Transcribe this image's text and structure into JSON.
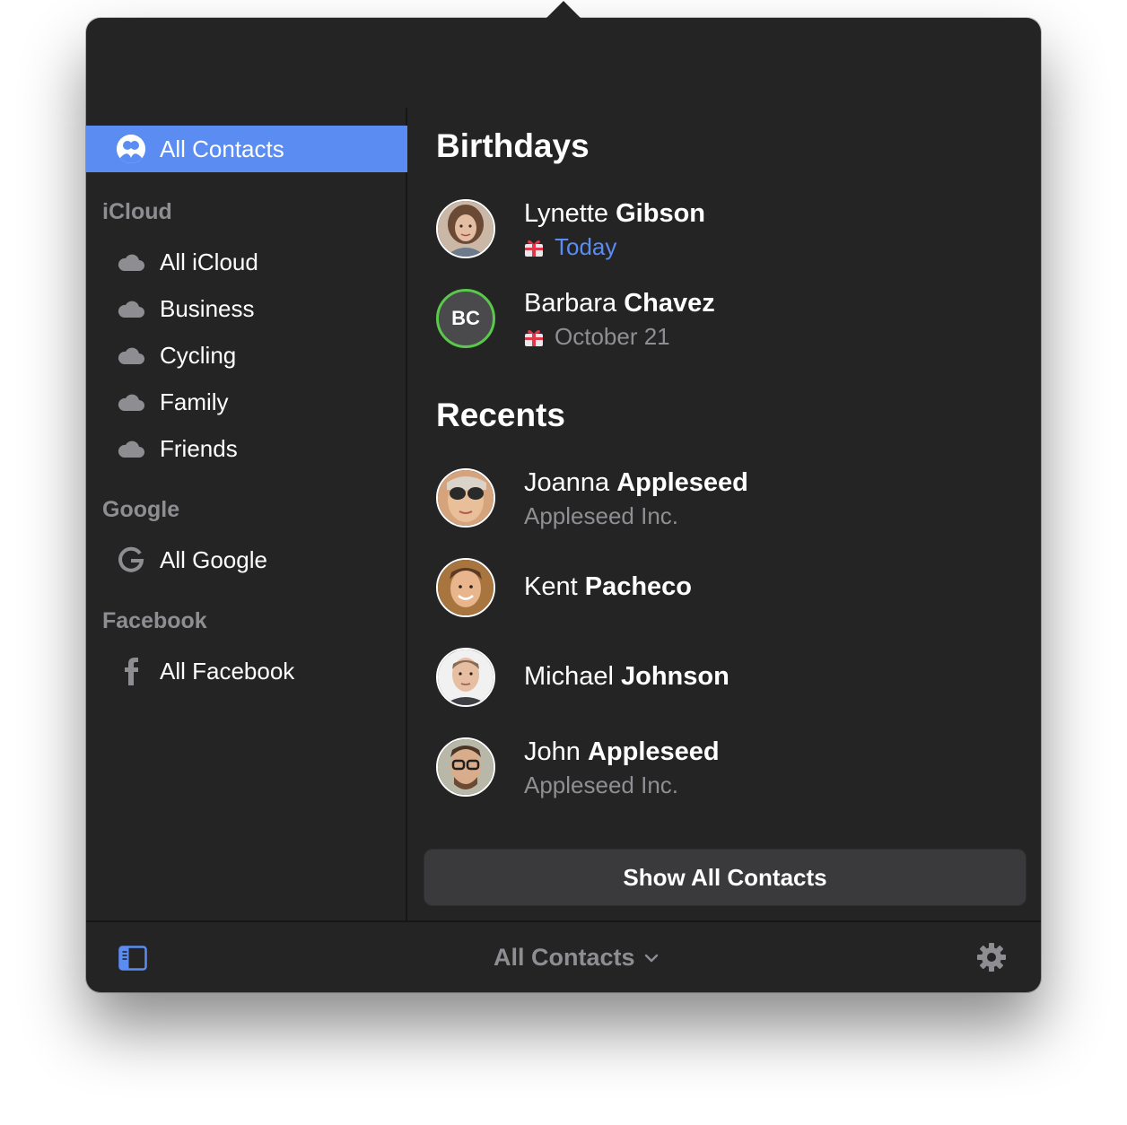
{
  "sidebar": {
    "selected": {
      "label": "All Contacts",
      "icon": "contacts-icon"
    },
    "sections": [
      {
        "header": "iCloud",
        "items": [
          {
            "label": "All iCloud",
            "icon": "cloud-icon"
          },
          {
            "label": "Business",
            "icon": "cloud-icon"
          },
          {
            "label": "Cycling",
            "icon": "cloud-icon"
          },
          {
            "label": "Family",
            "icon": "cloud-icon"
          },
          {
            "label": "Friends",
            "icon": "cloud-icon"
          }
        ]
      },
      {
        "header": "Google",
        "items": [
          {
            "label": "All Google",
            "icon": "google-icon"
          }
        ]
      },
      {
        "header": "Facebook",
        "items": [
          {
            "label": "All Facebook",
            "icon": "facebook-icon"
          }
        ]
      }
    ]
  },
  "birthdays": {
    "title": "Birthdays",
    "people": [
      {
        "first": "Lynette",
        "last": "Gibson",
        "date": "Today"
      },
      {
        "first": "Barbara",
        "last": "Chavez",
        "date": "October 21",
        "initials": "BC"
      }
    ]
  },
  "recents": {
    "title": "Recents",
    "people": [
      {
        "first": "Joanna",
        "last": "Appleseed",
        "company": "Appleseed Inc."
      },
      {
        "first": "Kent",
        "last": "Pacheco"
      },
      {
        "first": "Michael",
        "last": "Johnson"
      },
      {
        "first": "John",
        "last": "Appleseed",
        "company": "Appleseed Inc."
      }
    ]
  },
  "show_all_label": "Show All Contacts",
  "bottom_bar": {
    "scope_label": "All Contacts"
  },
  "colors": {
    "accent": "#5b8cf2",
    "background": "#242425",
    "ring_green": "#5ac84a"
  }
}
